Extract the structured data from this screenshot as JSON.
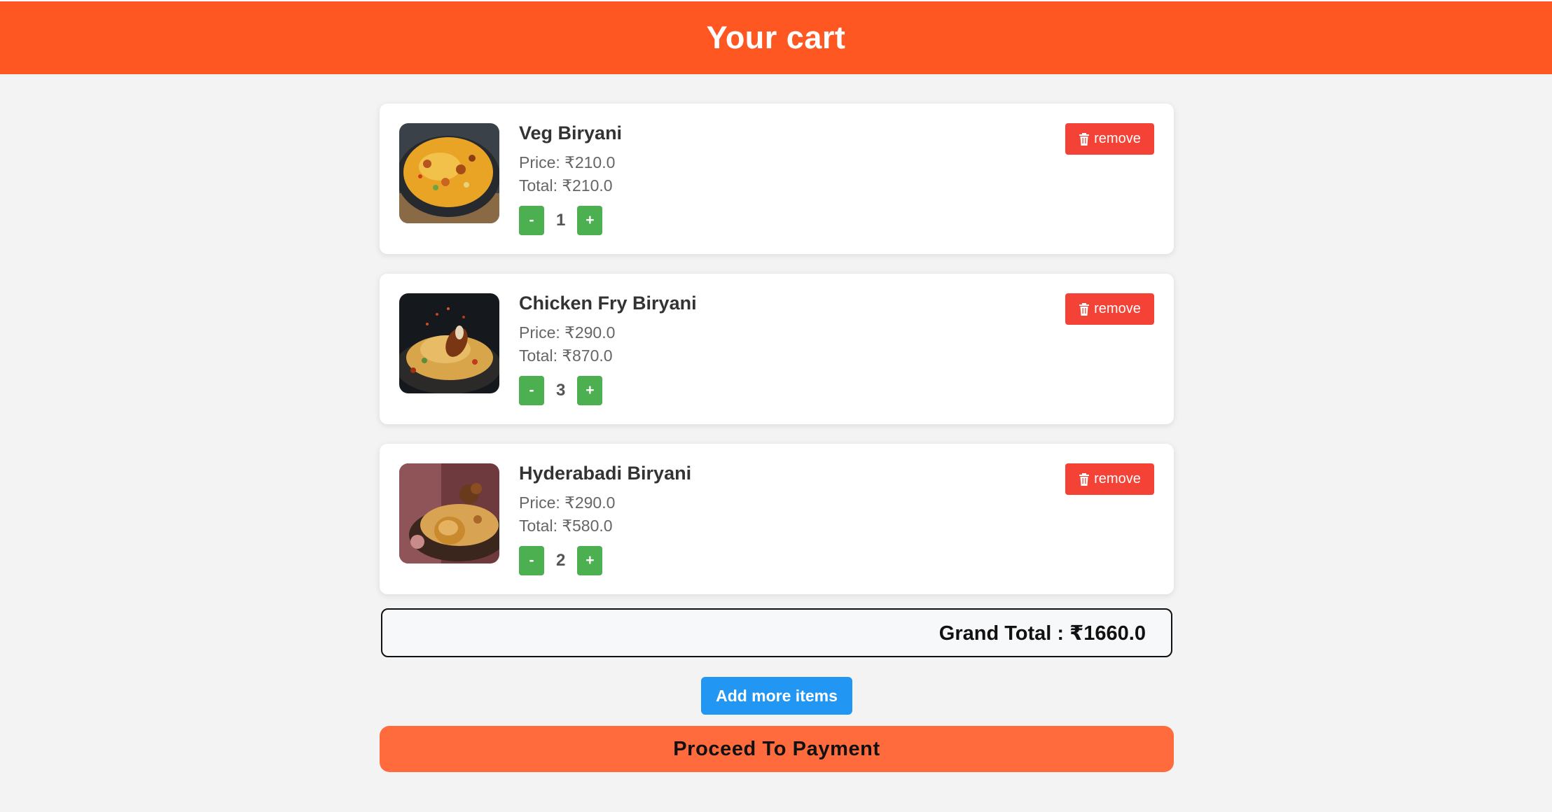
{
  "header": {
    "title": "Your cart"
  },
  "cart": {
    "items": [
      {
        "name": "Veg Biryani",
        "price_text": "Price: ₹210.0",
        "total_text": "Total: ₹210.0",
        "quantity": "1",
        "decrement_label": "-",
        "increment_label": "+",
        "remove_label": "remove",
        "image_icon": "veg-biryani-image"
      },
      {
        "name": "Chicken Fry Biryani",
        "price_text": "Price: ₹290.0",
        "total_text": "Total: ₹870.0",
        "quantity": "3",
        "decrement_label": "-",
        "increment_label": "+",
        "remove_label": "remove",
        "image_icon": "chicken-fry-biryani-image"
      },
      {
        "name": "Hyderabadi Biryani",
        "price_text": "Price: ₹290.0",
        "total_text": "Total: ₹580.0",
        "quantity": "2",
        "decrement_label": "-",
        "increment_label": "+",
        "remove_label": "remove",
        "image_icon": "hyderabadi-biryani-image"
      }
    ]
  },
  "summary": {
    "grand_total_text": "Grand Total : ₹1660.0"
  },
  "actions": {
    "add_more_label": "Add more items",
    "proceed_label": "Proceed To Payment"
  },
  "colors": {
    "header_bg": "#ff5722",
    "remove_bg": "#f44336",
    "qty_button_bg": "#4caf50",
    "add_more_bg": "#2196f3",
    "proceed_bg": "#ff6b3d"
  }
}
